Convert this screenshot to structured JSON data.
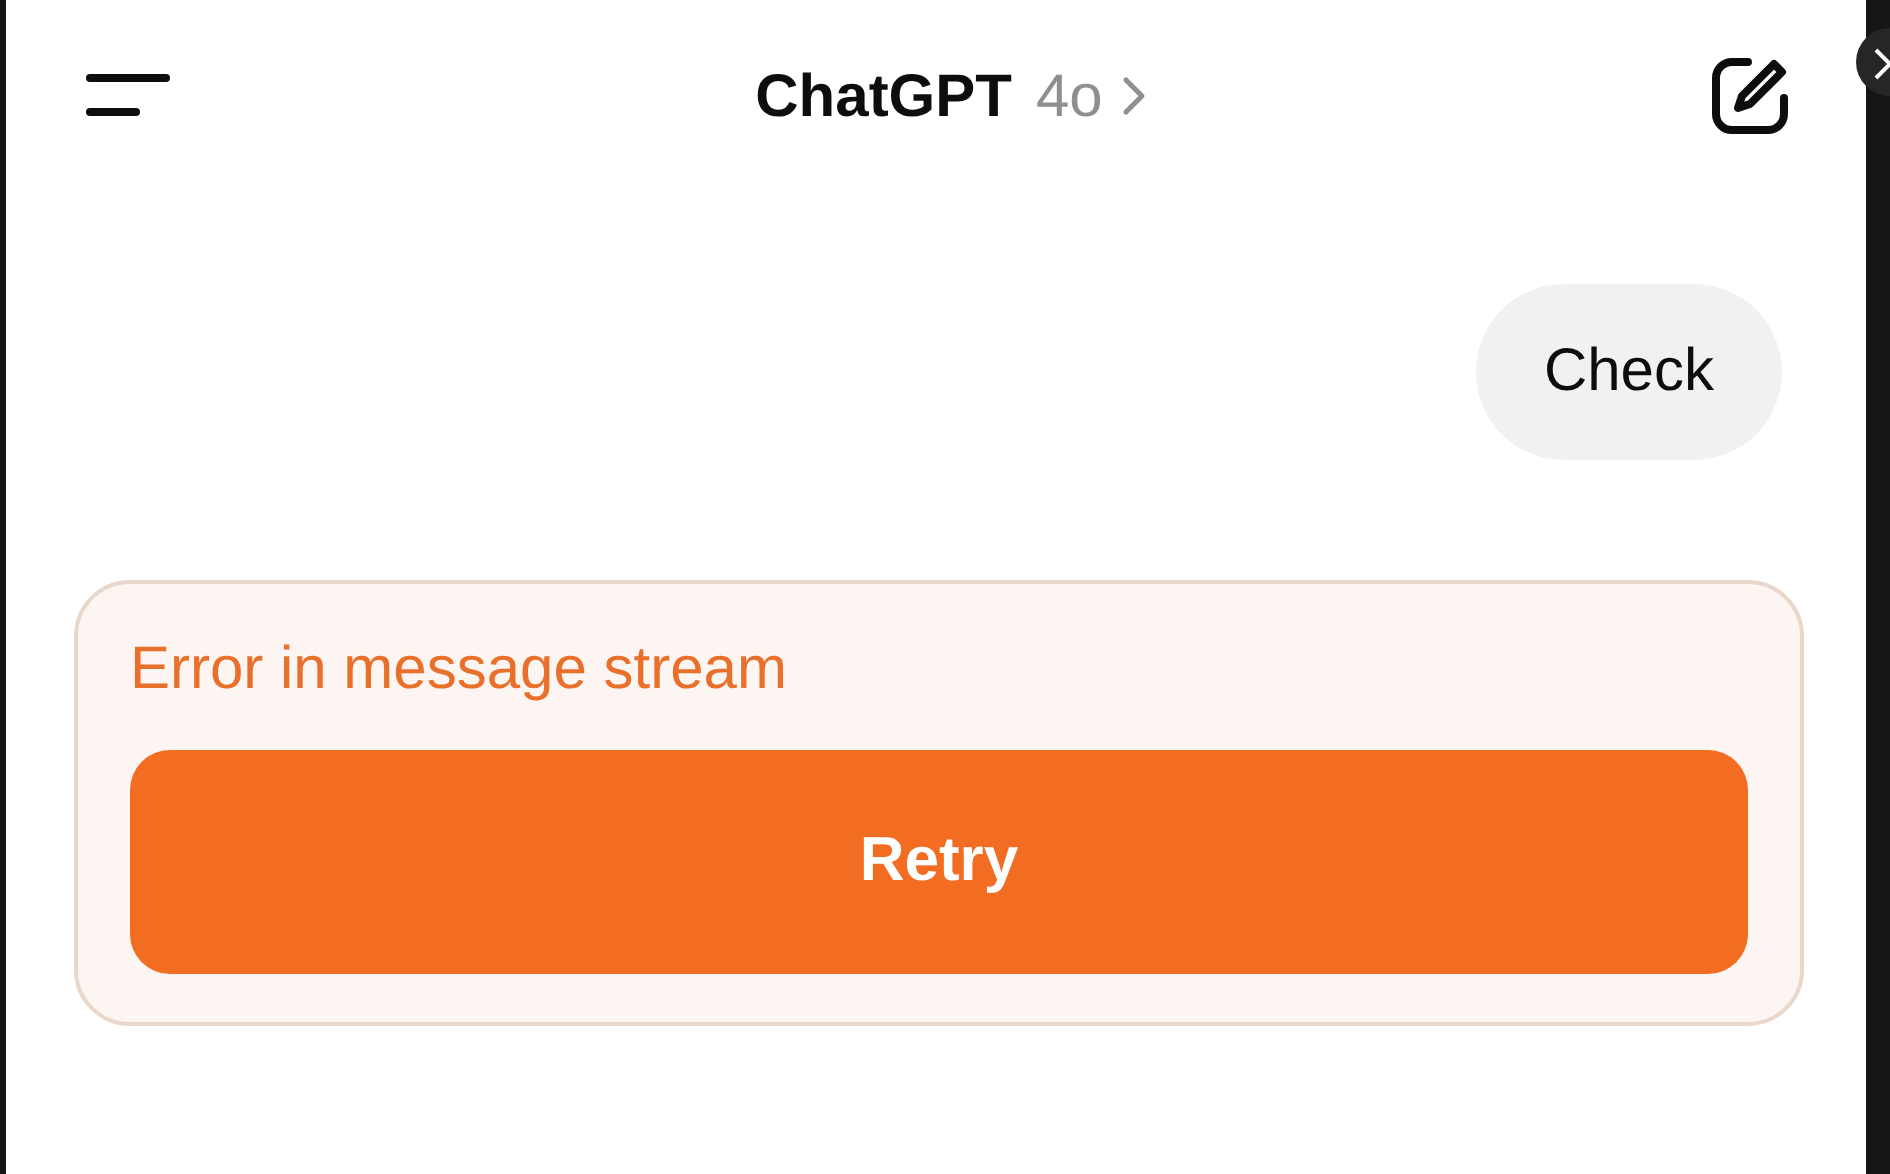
{
  "header": {
    "title": "ChatGPT",
    "model": "4o"
  },
  "messages": [
    {
      "kind": "user",
      "text": "Check"
    }
  ],
  "error": {
    "message": "Error in message stream",
    "button": "Retry"
  }
}
